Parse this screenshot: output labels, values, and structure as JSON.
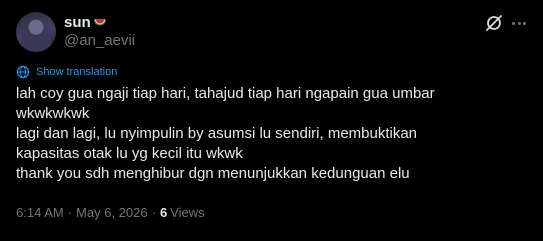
{
  "author": {
    "display_name": "sun",
    "handle": "@an_aevii"
  },
  "translate": {
    "label": "Show translation"
  },
  "tweet": {
    "lines": [
      "lah coy gua ngaji tiap hari, tahajud tiap hari ngapain gua umbar wkwkwkwk",
      "lagi dan lagi, lu nyimpulin by asumsi lu sendiri, membuktikan kapasitas otak lu yg kecil itu wkwk",
      "thank you sdh menghibur dgn menunjukkan kedunguan elu"
    ]
  },
  "meta": {
    "time": "6:14 AM",
    "separator": "·",
    "date": "May 6, 2026",
    "views_count": "6",
    "views_label": "Views"
  },
  "colors": {
    "background": "#000000",
    "text_primary": "#e7e9ea",
    "text_secondary": "#71767b",
    "accent": "#1d9bf0"
  },
  "icons": [
    "watermelon-emoji",
    "grok-icon",
    "more-options-icon",
    "translate-globe-icon"
  ]
}
